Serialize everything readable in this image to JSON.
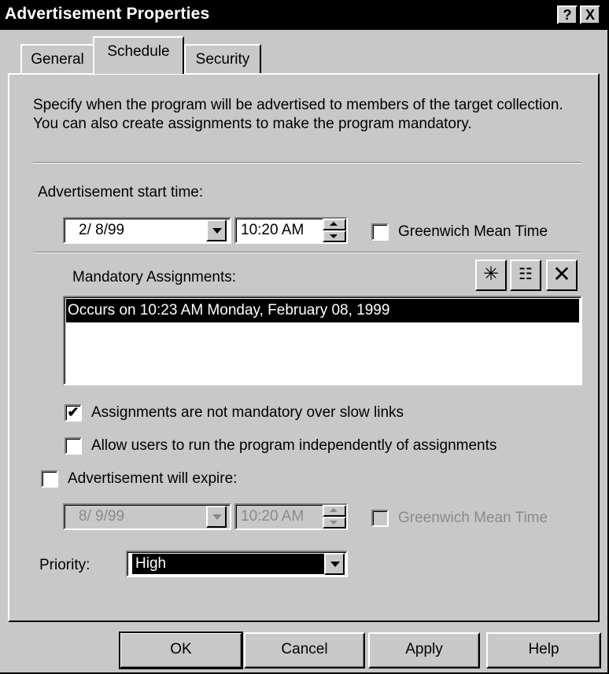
{
  "window": {
    "title": "Advertisement Properties",
    "help_button": "?",
    "close_button": "X"
  },
  "tabs": [
    {
      "label": "General"
    },
    {
      "label": "Schedule"
    },
    {
      "label": "Security"
    }
  ],
  "schedule": {
    "description": "Specify when the program will be advertised to members of the target collection. You can also create assignments to make the program mandatory.",
    "start_time_label": "Advertisement start time:",
    "start_date": "2/ 8/99",
    "start_time": "10:20 AM",
    "gmt_label": "Greenwich Mean Time",
    "gmt_checked": false,
    "mandatory_label": "Mandatory Assignments:",
    "toolbar_icons": [
      "new-icon",
      "properties-icon",
      "delete-icon"
    ],
    "assignments": [
      "Occurs on 10:23 AM Monday, February 08, 1999"
    ],
    "slow_links_label": "Assignments are not mandatory over slow links",
    "slow_links_checked": true,
    "allow_users_label": "Allow users to run the program independently of assignments",
    "allow_users_checked": false,
    "expire_label": "Advertisement will expire:",
    "expire_checked": false,
    "expire_date": "8/ 9/99",
    "expire_time": "10:20 AM",
    "expire_gmt_label": "Greenwich Mean Time",
    "priority_label": "Priority:",
    "priority_value": "High"
  },
  "buttons": {
    "ok": "OK",
    "cancel": "Cancel",
    "apply": "Apply",
    "help": "Help"
  }
}
